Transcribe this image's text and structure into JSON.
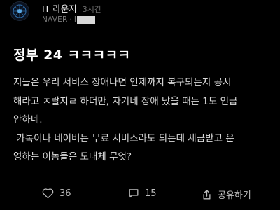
{
  "header": {
    "group_name": "IT 라운지",
    "time_ago": "3시간",
    "source": "NAVER",
    "separator": "·",
    "author_prefix": "I"
  },
  "post": {
    "title": "정부 24 ㅋㅋㅋㅋㅋ",
    "body_lines": [
      "지들은 우리 서비스 장애나면 언제까지 복구되는지 공시",
      "해라고 ㅈ랄지ㄹ 하더만, 자기네 장애 났을 때는 1도 언급",
      "안하네.",
      " 카톡이나 네이버는 무료 서비스라도 되는데 세금받고 운",
      "영하는 이놈들은 도대체 무엇?"
    ]
  },
  "actions": {
    "like_count": "36",
    "comment_count": "15",
    "share_label": "공유하기"
  },
  "icons": {
    "like": "heart-icon",
    "comment": "comment-icon",
    "share": "share-icon"
  },
  "colors": {
    "background": "#000000",
    "text": "#d9d9d9",
    "muted": "#7c7c7c"
  }
}
